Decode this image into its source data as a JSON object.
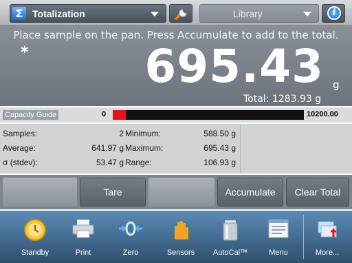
{
  "topbar": {
    "mode_icon": "Σ",
    "mode_label": "Totalization",
    "wrench_icon": "wrench-icon",
    "library_label": "Library",
    "info_icon": "i"
  },
  "display": {
    "instruction": "Place sample on the pan.  Press Accumulate to add to the total.",
    "stable_indicator": "*",
    "weight": "695.43",
    "unit": "g",
    "total_text": "Total: 1283.93 g"
  },
  "capacity_guide": {
    "label": "Capacity Guide",
    "min": "0",
    "max": "10200.00",
    "fill_fraction": 0.068,
    "fill_color": "#e1141b"
  },
  "stats": {
    "samples_label": "Samples:",
    "samples_value": "2",
    "average_label": "Average:",
    "average_value": "641.97 g",
    "stdev_label": "σ (stdev):",
    "stdev_value": "53.47 g",
    "minimum_label": "Minimum:",
    "minimum_value": "588.50 g",
    "maximum_label": "Maximum:",
    "maximum_value": "695.43 g",
    "range_label": "Range:",
    "range_value": "106.93 g"
  },
  "actions": {
    "tare": "Tare",
    "accumulate": "Accumulate",
    "clear_total": "Clear Total"
  },
  "nav": {
    "standby": "Standby",
    "print": "Print",
    "zero": "Zero",
    "sensors": "Sensors",
    "autocal": "AutoCal™",
    "menu": "Menu",
    "more": "More..."
  }
}
